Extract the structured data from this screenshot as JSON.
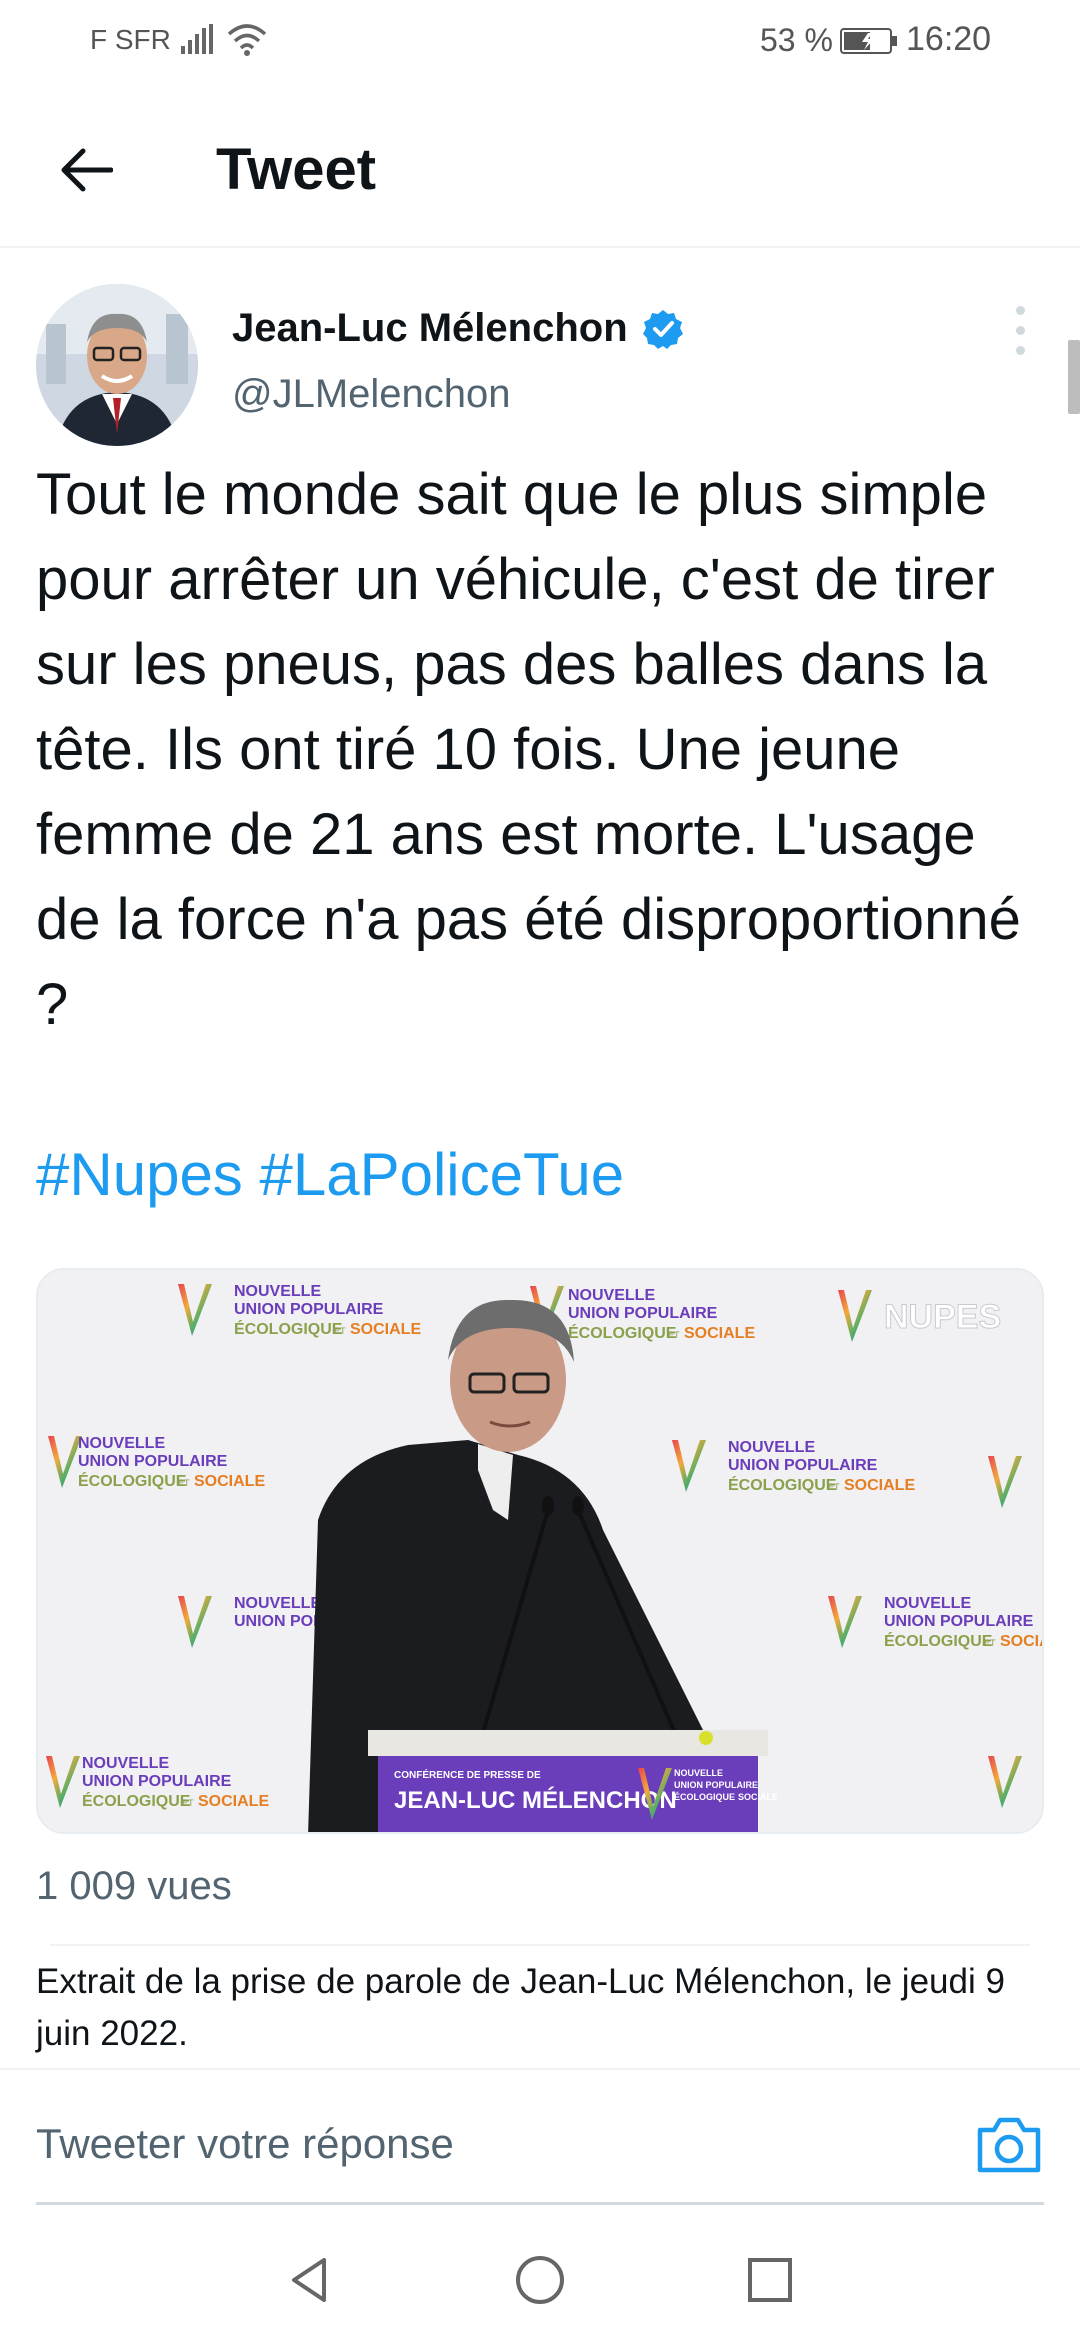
{
  "status_bar": {
    "carrier": "F SFR",
    "battery_percent": "53 %",
    "time": "16:20"
  },
  "header": {
    "title": "Tweet"
  },
  "tweet": {
    "author_name": "Jean-Luc Mélenchon",
    "author_handle": "@JLMelenchon",
    "text": "Tout le monde sait que le plus simple pour arrêter un véhicule, c'est de tirer sur les pneus, pas des balles dans la tête. Ils ont tiré 10 fois. Une jeune femme de 21 ans est morte. L'usage de la force n'a pas été disproportionné ?",
    "hashtags": [
      "#Nupes",
      "#LaPoliceTue"
    ],
    "views": "1 009 vues",
    "caption": "Extrait de la prise de parole de Jean-Luc Mélenchon, le jeudi 9 juin 2022."
  },
  "media": {
    "backdrop_line1": "NOUVELLE",
    "backdrop_line2": "UNION POPULAIRE",
    "backdrop_line3a": "ÉCOLOGIQUE",
    "backdrop_line3b": "ET",
    "backdrop_line3c": "SOCIALE",
    "corner_logo": "NUPES",
    "podium_small": "CONFÉRENCE DE PRESSE DE",
    "podium_name": "JEAN-LUC MÉLENCHON"
  },
  "reply": {
    "placeholder": "Tweeter votre réponse"
  },
  "colors": {
    "accent": "#1d9bf0",
    "text": "#0f1419",
    "secondary": "#536471",
    "podium_purple": "#6a3dbb"
  }
}
